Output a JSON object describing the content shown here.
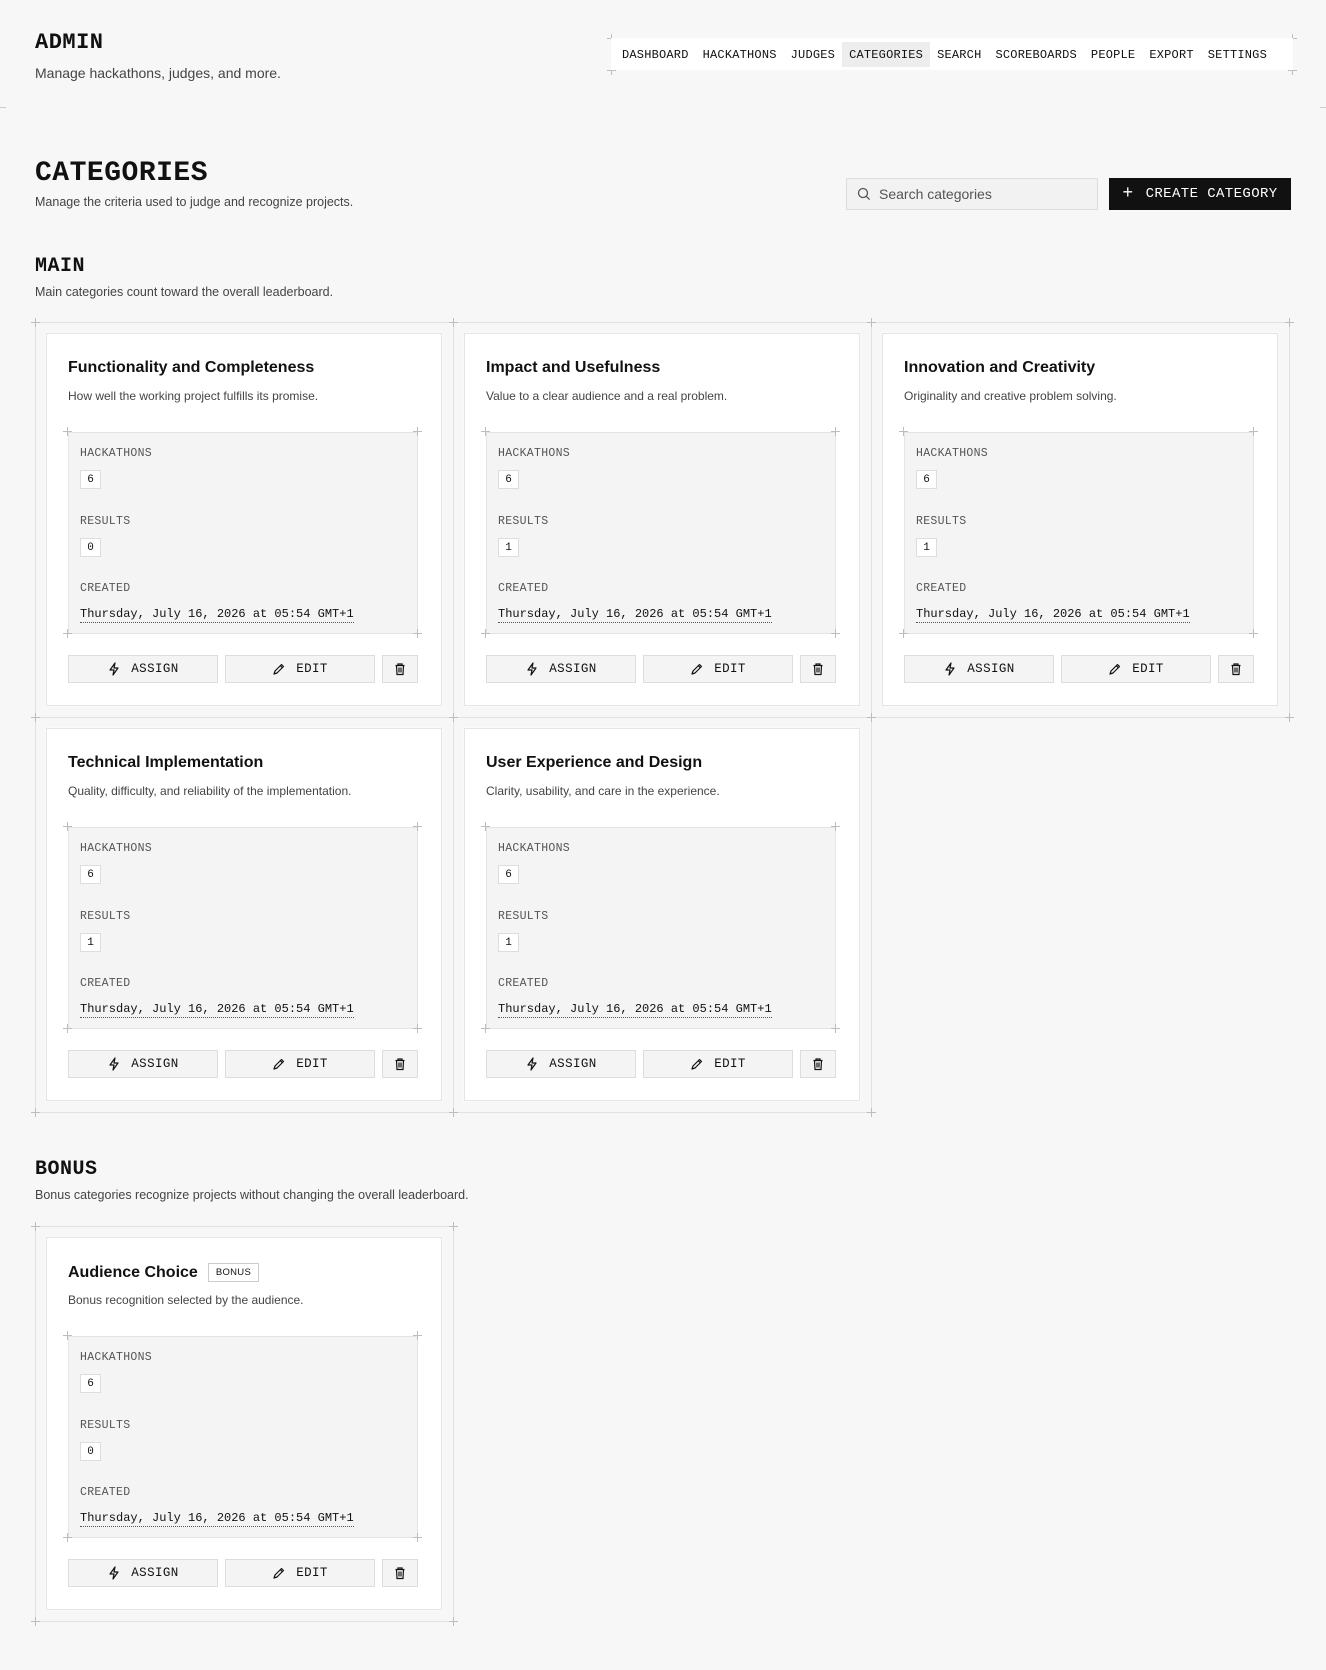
{
  "header": {
    "title": "ADMIN",
    "subtitle": "Manage hackathons, judges, and more."
  },
  "nav": {
    "tabs": [
      {
        "label": "DASHBOARD",
        "active": false
      },
      {
        "label": "HACKATHONS",
        "active": false
      },
      {
        "label": "JUDGES",
        "active": false
      },
      {
        "label": "CATEGORIES",
        "active": true
      },
      {
        "label": "SEARCH",
        "active": false
      },
      {
        "label": "SCOREBOARDS",
        "active": false
      },
      {
        "label": "PEOPLE",
        "active": false
      },
      {
        "label": "EXPORT",
        "active": false
      },
      {
        "label": "SETTINGS",
        "active": false
      }
    ]
  },
  "page": {
    "title": "CATEGORIES",
    "subtitle": "Manage the criteria used to judge and recognize projects.",
    "search_placeholder": "Search categories",
    "create_label": "CREATE CATEGORY",
    "create_icon": "plus-icon"
  },
  "labels": {
    "hackathons": "HACKATHONS",
    "results": "RESULTS",
    "created": "CREATED",
    "assign": "ASSIGN",
    "edit": "EDIT"
  },
  "main": {
    "title": "MAIN",
    "subtitle": "Main categories count toward the overall leaderboard.",
    "cards": [
      {
        "title": "Functionality and Completeness",
        "desc": "How well the working project fulfills its promise.",
        "hackathons": "6",
        "results": "0",
        "created": "Thursday, July 16, 2026 at 05:54 GMT+1"
      },
      {
        "title": "Impact and Usefulness",
        "desc": "Value to a clear audience and a real problem.",
        "hackathons": "6",
        "results": "1",
        "created": "Thursday, July 16, 2026 at 05:54 GMT+1"
      },
      {
        "title": "Innovation and Creativity",
        "desc": "Originality and creative problem solving.",
        "hackathons": "6",
        "results": "1",
        "created": "Thursday, July 16, 2026 at 05:54 GMT+1"
      },
      {
        "title": "Technical Implementation",
        "desc": "Quality, difficulty, and reliability of the implementation.",
        "hackathons": "6",
        "results": "1",
        "created": "Thursday, July 16, 2026 at 05:54 GMT+1"
      },
      {
        "title": "User Experience and Design",
        "desc": "Clarity, usability, and care in the experience.",
        "hackathons": "6",
        "results": "1",
        "created": "Thursday, July 16, 2026 at 05:54 GMT+1"
      }
    ]
  },
  "bonus": {
    "title": "BONUS",
    "subtitle": "Bonus categories recognize projects without changing the overall leaderboard.",
    "cards": [
      {
        "title": "Audience Choice",
        "badge": "BONUS",
        "desc": "Bonus recognition selected by the audience.",
        "hackathons": "6",
        "results": "0",
        "created": "Thursday, July 16, 2026 at 05:54 GMT+1"
      }
    ]
  }
}
